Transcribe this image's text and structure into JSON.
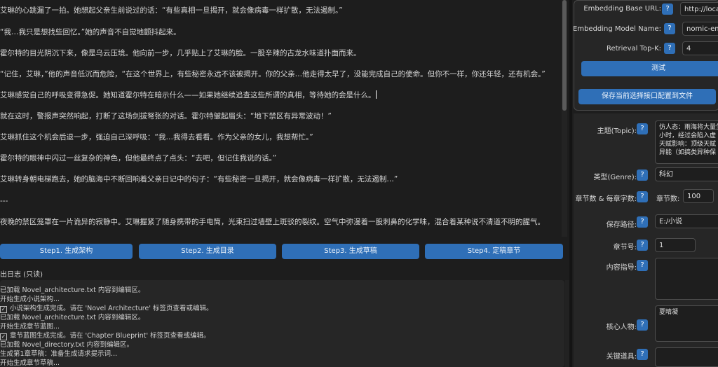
{
  "editor": {
    "lines": [
      "艾琳的心跳漏了一拍。她想起父亲生前说过的话：“有些真相一旦揭开，就会像病毒一样扩散，无法遏制。”",
      "“我…我只是想找些回忆。”她的声音不自觉地颤抖起来。",
      "霍尔特的目光阴沉下来，像是乌云压境。他向前一步，几乎贴上了艾琳的脸。一股辛辣的古龙水味道扑面而来。",
      "“记住，艾琳，”他的声音低沉而危险，“在这个世界上，有些秘密永远不该被揭开。你的父亲…他走得太早了，没能完成自己的使命。但你不一样，你还年轻，还有机会。”",
      "艾琳感觉自己的呼吸变得急促。她知道霍尔特在暗示什么——如果她继续追查这些所谓的真相，等待她的会是什么。",
      "就在这时，警报声突然响起，打断了这场剑拔弩张的对话。霍尔特皱起眉头：“地下禁区有异常波动！”",
      "艾琳抓住这个机会后退一步，强迫自己深呼吸：“我…我得去看看。作为父亲的女儿，我想帮忙。”",
      "霍尔特的眼神中闪过一丝复杂的神色，但他最终点了点头：“去吧，但记住我说的话。”",
      "艾琳转身朝电梯跑去，她的脑海中不断回响着父亲日记中的句子：“有些秘密一旦揭开，就会像病毒一样扩散，无法遏制…”",
      "---",
      "夜晚的禁区笼罩在一片诡异的寂静中。艾琳握紧了随身携带的手电筒，光束扫过墙壁上斑驳的裂纹。空气中弥漫着一股刺鼻的化学味，混合着某种说不清道不明的腥气。"
    ]
  },
  "steps": [
    "Step1. 生成架构",
    "Step2. 生成目录",
    "Step3. 生成草稿",
    "Step4. 定稿章节"
  ],
  "log": {
    "label": "出日志 (只读)",
    "lines": [
      {
        "check": false,
        "text": "已加载 Novel_architecture.txt 内容到编辑区。"
      },
      {
        "check": false,
        "text": "开始生成小说架构..."
      },
      {
        "check": true,
        "text": "小说架构生成完成。请在 'Novel Architecture' 标签页查看或编辑。"
      },
      {
        "check": false,
        "text": "已加载 Novel_architecture.txt 内容到编辑区。"
      },
      {
        "check": false,
        "text": "开始生成章节蓝图..."
      },
      {
        "check": true,
        "text": "章节蓝图生成完成。请在 'Chapter Blueprint' 标签页查看或编辑。"
      },
      {
        "check": false,
        "text": "已加载 Novel_directory.txt 内容到编辑区。"
      },
      {
        "check": false,
        "text": "生成第1章草稿：准备生成请求提示词..."
      },
      {
        "check": false,
        "text": "开始生成章节草稿..."
      }
    ]
  },
  "config": {
    "embedding_base_url_label": "Embedding Base URL:",
    "embedding_base_url_value": "http://local",
    "embedding_model_label": "Embedding Model Name:",
    "embedding_model_value": "nomic-emb",
    "retrieval_topk_label": "Retrieval Top-K:",
    "retrieval_topk_value": "4",
    "test_button": "测试",
    "save_button": "保存当前选择接口配置到文件",
    "help": "?"
  },
  "params": {
    "topic_label": "主题(Topic):",
    "topic_value": "仿人态：雨海将大量生\n小时，经过会陷入虚\n天赋影响：顶级天赋\n异能（如搞类异种保",
    "genre_label": "类型(Genre):",
    "genre_value": "科幻",
    "chapters_label": "章节数 & 每章字数:",
    "chapters_inner_label": "章节数:",
    "chapters_value": "100",
    "save_path_label": "保存路径:",
    "save_path_value": "E:/小说",
    "chapter_no_label": "章节号:",
    "chapter_no_value": "1",
    "guidance_label": "内容指导:",
    "guidance_value": "",
    "characters_label": "核心人物:",
    "characters_value": "夏晴凝",
    "key_items_label": "关键道具:",
    "key_items_value": ""
  }
}
